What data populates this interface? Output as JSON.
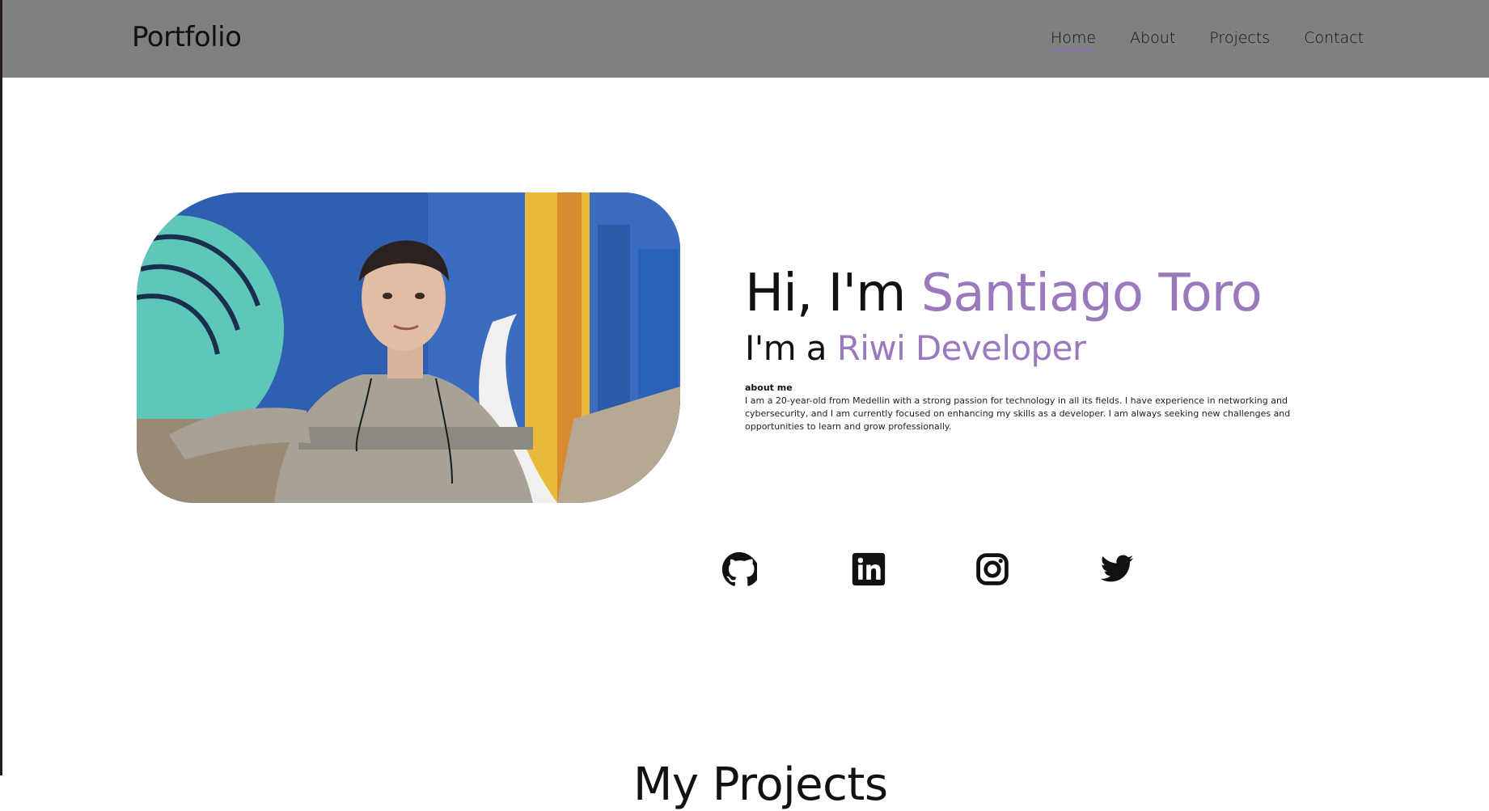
{
  "nav": {
    "logo": "Portfolio",
    "links": [
      "Home",
      "About",
      "Projects",
      "Contact"
    ],
    "active": "Home",
    "background": "#808080",
    "active_underline": "#8e6fbd"
  },
  "hero": {
    "photo_alt": "Portrait photo in front of a colorful mural",
    "greeting_prefix": "Hi, I'm ",
    "name": "Santiago Toro",
    "role_prefix": "I'm a ",
    "role": "Riwi Developer",
    "about_label": "about me",
    "about_text": "I am a 20-year-old from Medellin with a strong passion for technology in all its fields. I have experience in networking and cybersecurity, and I am currently focused on enhancing my skills as a developer. I am always seeking new challenges and opportunities to learn and grow professionally.",
    "accent_color": "#9b79bd"
  },
  "socials": [
    {
      "name": "github-icon"
    },
    {
      "name": "linkedin-icon"
    },
    {
      "name": "instagram-icon"
    },
    {
      "name": "twitter-icon"
    }
  ],
  "projects": {
    "heading": "My Projects"
  }
}
